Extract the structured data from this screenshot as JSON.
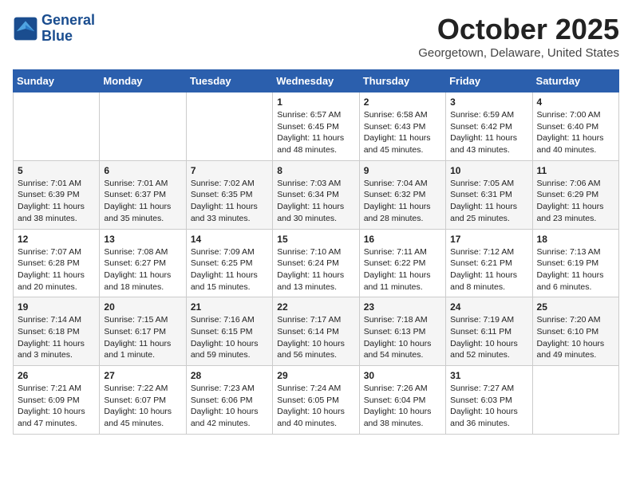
{
  "header": {
    "logo_line1": "General",
    "logo_line2": "Blue",
    "month_title": "October 2025",
    "location": "Georgetown, Delaware, United States"
  },
  "weekdays": [
    "Sunday",
    "Monday",
    "Tuesday",
    "Wednesday",
    "Thursday",
    "Friday",
    "Saturday"
  ],
  "weeks": [
    [
      {
        "day": "",
        "info": ""
      },
      {
        "day": "",
        "info": ""
      },
      {
        "day": "",
        "info": ""
      },
      {
        "day": "1",
        "info": "Sunrise: 6:57 AM\nSunset: 6:45 PM\nDaylight: 11 hours\nand 48 minutes."
      },
      {
        "day": "2",
        "info": "Sunrise: 6:58 AM\nSunset: 6:43 PM\nDaylight: 11 hours\nand 45 minutes."
      },
      {
        "day": "3",
        "info": "Sunrise: 6:59 AM\nSunset: 6:42 PM\nDaylight: 11 hours\nand 43 minutes."
      },
      {
        "day": "4",
        "info": "Sunrise: 7:00 AM\nSunset: 6:40 PM\nDaylight: 11 hours\nand 40 minutes."
      }
    ],
    [
      {
        "day": "5",
        "info": "Sunrise: 7:01 AM\nSunset: 6:39 PM\nDaylight: 11 hours\nand 38 minutes."
      },
      {
        "day": "6",
        "info": "Sunrise: 7:01 AM\nSunset: 6:37 PM\nDaylight: 11 hours\nand 35 minutes."
      },
      {
        "day": "7",
        "info": "Sunrise: 7:02 AM\nSunset: 6:35 PM\nDaylight: 11 hours\nand 33 minutes."
      },
      {
        "day": "8",
        "info": "Sunrise: 7:03 AM\nSunset: 6:34 PM\nDaylight: 11 hours\nand 30 minutes."
      },
      {
        "day": "9",
        "info": "Sunrise: 7:04 AM\nSunset: 6:32 PM\nDaylight: 11 hours\nand 28 minutes."
      },
      {
        "day": "10",
        "info": "Sunrise: 7:05 AM\nSunset: 6:31 PM\nDaylight: 11 hours\nand 25 minutes."
      },
      {
        "day": "11",
        "info": "Sunrise: 7:06 AM\nSunset: 6:29 PM\nDaylight: 11 hours\nand 23 minutes."
      }
    ],
    [
      {
        "day": "12",
        "info": "Sunrise: 7:07 AM\nSunset: 6:28 PM\nDaylight: 11 hours\nand 20 minutes."
      },
      {
        "day": "13",
        "info": "Sunrise: 7:08 AM\nSunset: 6:27 PM\nDaylight: 11 hours\nand 18 minutes."
      },
      {
        "day": "14",
        "info": "Sunrise: 7:09 AM\nSunset: 6:25 PM\nDaylight: 11 hours\nand 15 minutes."
      },
      {
        "day": "15",
        "info": "Sunrise: 7:10 AM\nSunset: 6:24 PM\nDaylight: 11 hours\nand 13 minutes."
      },
      {
        "day": "16",
        "info": "Sunrise: 7:11 AM\nSunset: 6:22 PM\nDaylight: 11 hours\nand 11 minutes."
      },
      {
        "day": "17",
        "info": "Sunrise: 7:12 AM\nSunset: 6:21 PM\nDaylight: 11 hours\nand 8 minutes."
      },
      {
        "day": "18",
        "info": "Sunrise: 7:13 AM\nSunset: 6:19 PM\nDaylight: 11 hours\nand 6 minutes."
      }
    ],
    [
      {
        "day": "19",
        "info": "Sunrise: 7:14 AM\nSunset: 6:18 PM\nDaylight: 11 hours\nand 3 minutes."
      },
      {
        "day": "20",
        "info": "Sunrise: 7:15 AM\nSunset: 6:17 PM\nDaylight: 11 hours\nand 1 minute."
      },
      {
        "day": "21",
        "info": "Sunrise: 7:16 AM\nSunset: 6:15 PM\nDaylight: 10 hours\nand 59 minutes."
      },
      {
        "day": "22",
        "info": "Sunrise: 7:17 AM\nSunset: 6:14 PM\nDaylight: 10 hours\nand 56 minutes."
      },
      {
        "day": "23",
        "info": "Sunrise: 7:18 AM\nSunset: 6:13 PM\nDaylight: 10 hours\nand 54 minutes."
      },
      {
        "day": "24",
        "info": "Sunrise: 7:19 AM\nSunset: 6:11 PM\nDaylight: 10 hours\nand 52 minutes."
      },
      {
        "day": "25",
        "info": "Sunrise: 7:20 AM\nSunset: 6:10 PM\nDaylight: 10 hours\nand 49 minutes."
      }
    ],
    [
      {
        "day": "26",
        "info": "Sunrise: 7:21 AM\nSunset: 6:09 PM\nDaylight: 10 hours\nand 47 minutes."
      },
      {
        "day": "27",
        "info": "Sunrise: 7:22 AM\nSunset: 6:07 PM\nDaylight: 10 hours\nand 45 minutes."
      },
      {
        "day": "28",
        "info": "Sunrise: 7:23 AM\nSunset: 6:06 PM\nDaylight: 10 hours\nand 42 minutes."
      },
      {
        "day": "29",
        "info": "Sunrise: 7:24 AM\nSunset: 6:05 PM\nDaylight: 10 hours\nand 40 minutes."
      },
      {
        "day": "30",
        "info": "Sunrise: 7:26 AM\nSunset: 6:04 PM\nDaylight: 10 hours\nand 38 minutes."
      },
      {
        "day": "31",
        "info": "Sunrise: 7:27 AM\nSunset: 6:03 PM\nDaylight: 10 hours\nand 36 minutes."
      },
      {
        "day": "",
        "info": ""
      }
    ]
  ]
}
